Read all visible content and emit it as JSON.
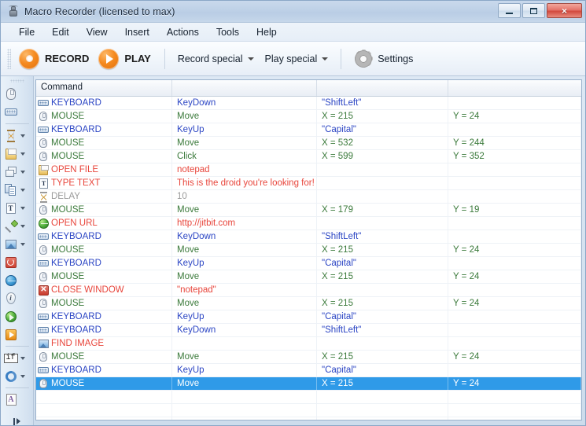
{
  "window": {
    "title": "Macro Recorder (licensed to max)",
    "icon": "bug-icon",
    "buttons": {
      "minimize": "minimize-button",
      "maximize": "maximize-button",
      "close": "×"
    }
  },
  "menu": {
    "items": [
      "File",
      "Edit",
      "View",
      "Insert",
      "Actions",
      "Tools",
      "Help"
    ]
  },
  "toolbar": {
    "record_label": "RECORD",
    "play_label": "PLAY",
    "record_special_label": "Record special",
    "play_special_label": "Play special",
    "settings_label": "Settings"
  },
  "rail": {
    "items": [
      {
        "name": "mouse-icon",
        "caret": false
      },
      {
        "name": "keyboard-icon",
        "caret": false
      },
      {
        "sep": true
      },
      {
        "name": "delay-icon",
        "caret": true
      },
      {
        "name": "open-file-icon",
        "caret": true
      },
      {
        "name": "window-icon",
        "caret": true
      },
      {
        "name": "copy-icon",
        "caret": true
      },
      {
        "name": "type-text-icon",
        "caret": true
      },
      {
        "name": "color-picker-icon",
        "caret": true
      },
      {
        "name": "find-image-icon",
        "caret": true
      },
      {
        "name": "stop-icon",
        "caret": false
      },
      {
        "name": "blue-globe-icon",
        "caret": false
      },
      {
        "name": "info-icon",
        "caret": false
      },
      {
        "name": "open-url-icon",
        "caret": false
      },
      {
        "name": "run-icon",
        "caret": false
      },
      {
        "sep": true
      },
      {
        "name": "if-icon",
        "caret": true,
        "text": "if"
      },
      {
        "name": "loop-icon",
        "caret": true
      },
      {
        "sep": true
      },
      {
        "name": "text-icon",
        "caret": false,
        "text": "A"
      }
    ]
  },
  "grid": {
    "headers": [
      "Command",
      "",
      "",
      ""
    ],
    "rows": [
      {
        "icon": "keyboard-icon",
        "color": "t-blue",
        "c0": "KEYBOARD",
        "c1": "KeyDown",
        "c2": "\"ShiftLeft\"",
        "c3": ""
      },
      {
        "icon": "mouse-icon",
        "color": "t-green",
        "c0": "MOUSE",
        "c1": "Move",
        "c2": "X = 215",
        "c3": "Y = 24"
      },
      {
        "icon": "keyboard-icon",
        "color": "t-blue",
        "c0": "KEYBOARD",
        "c1": "KeyUp",
        "c2": "\"Capital\"",
        "c3": ""
      },
      {
        "icon": "mouse-icon",
        "color": "t-green",
        "c0": "MOUSE",
        "c1": "Move",
        "c2": "X = 532",
        "c3": "Y = 244"
      },
      {
        "icon": "mouse-icon",
        "color": "t-green",
        "c0": "MOUSE",
        "c1": "Click",
        "c2": "X = 599",
        "c3": "Y = 352"
      },
      {
        "icon": "open-file-icon",
        "color": "t-red",
        "c0": "OPEN FILE",
        "c1": "notepad",
        "c2": "",
        "c3": ""
      },
      {
        "icon": "type-text-icon",
        "color": "t-red",
        "c0": "TYPE TEXT",
        "c1": "This is the droid you're looking for!",
        "c2": "",
        "c3": ""
      },
      {
        "icon": "delay-icon",
        "color": "t-gray",
        "c0": "DELAY",
        "c1": "10",
        "c2": "",
        "c3": ""
      },
      {
        "icon": "mouse-icon",
        "color": "t-green",
        "c0": "MOUSE",
        "c1": "Move",
        "c2": "X = 179",
        "c3": "Y = 19"
      },
      {
        "icon": "open-url-icon",
        "color": "t-red",
        "c0": "OPEN URL",
        "c1": "http://jitbit.com",
        "c2": "",
        "c3": ""
      },
      {
        "icon": "keyboard-icon",
        "color": "t-blue",
        "c0": "KEYBOARD",
        "c1": "KeyDown",
        "c2": "\"ShiftLeft\"",
        "c3": ""
      },
      {
        "icon": "mouse-icon",
        "color": "t-green",
        "c0": "MOUSE",
        "c1": "Move",
        "c2": "X = 215",
        "c3": "Y = 24"
      },
      {
        "icon": "keyboard-icon",
        "color": "t-blue",
        "c0": "KEYBOARD",
        "c1": "KeyUp",
        "c2": "\"Capital\"",
        "c3": ""
      },
      {
        "icon": "mouse-icon",
        "color": "t-green",
        "c0": "MOUSE",
        "c1": "Move",
        "c2": "X = 215",
        "c3": "Y = 24"
      },
      {
        "icon": "close-window-icon",
        "color": "t-red",
        "c0": "CLOSE WINDOW",
        "c1": "\"notepad\"",
        "c2": "",
        "c3": ""
      },
      {
        "icon": "mouse-icon",
        "color": "t-green",
        "c0": "MOUSE",
        "c1": "Move",
        "c2": "X = 215",
        "c3": "Y = 24"
      },
      {
        "icon": "keyboard-icon",
        "color": "t-blue",
        "c0": "KEYBOARD",
        "c1": "KeyUp",
        "c2": "\"Capital\"",
        "c3": ""
      },
      {
        "icon": "keyboard-icon",
        "color": "t-blue",
        "c0": "KEYBOARD",
        "c1": "KeyDown",
        "c2": "\"ShiftLeft\"",
        "c3": ""
      },
      {
        "icon": "find-image-icon",
        "color": "t-red",
        "c0": "FIND IMAGE",
        "c1": "",
        "c2": "",
        "c3": ""
      },
      {
        "icon": "mouse-icon",
        "color": "t-green",
        "c0": "MOUSE",
        "c1": "Move",
        "c2": "X = 215",
        "c3": "Y = 24"
      },
      {
        "icon": "keyboard-icon",
        "color": "t-blue",
        "c0": "KEYBOARD",
        "c1": "KeyUp",
        "c2": "\"Capital\"",
        "c3": ""
      },
      {
        "icon": "mouse-icon",
        "color": "t-blue",
        "c0": "MOUSE",
        "c1": "Move",
        "c2": "X = 215",
        "c3": "Y = 24",
        "selected": true
      }
    ],
    "empty_row_count": 3
  },
  "colors": {
    "accent_orange": "#f58a1f",
    "selection_blue": "#2f9ae8",
    "command_blue": "#2b45c4",
    "command_green": "#3b7a3b",
    "command_red": "#e8463c",
    "command_gray": "#9a9a9a"
  }
}
